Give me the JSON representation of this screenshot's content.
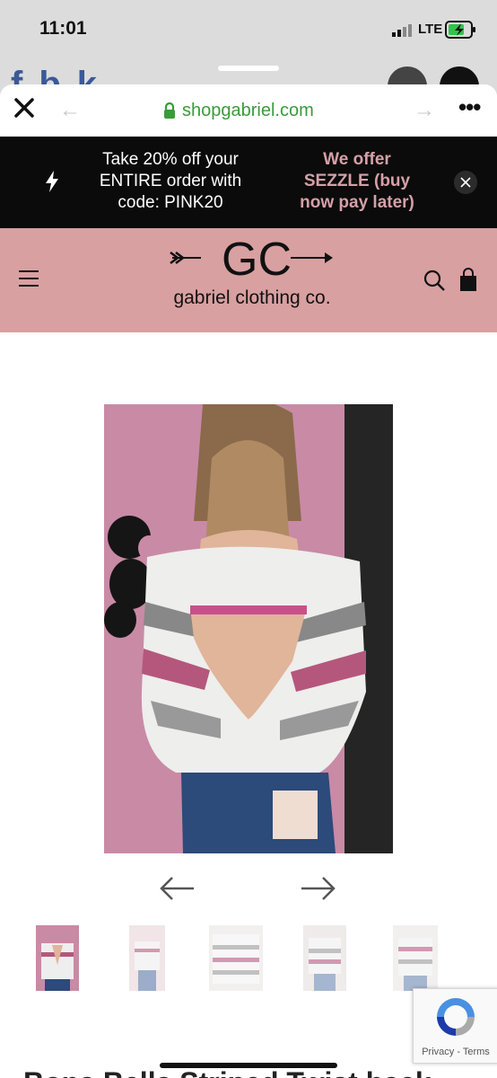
{
  "status_bar": {
    "time": "11:01",
    "network": "LTE"
  },
  "browser": {
    "url": "shopgabriel.com"
  },
  "promo": {
    "message": "Take 20% off your ENTIRE order with code: PINK20",
    "sezzle": "We offer SEZZLE (buy now pay later)"
  },
  "brand": {
    "monogram": "GC",
    "name": "gabriel clothing co."
  },
  "recaptcha": {
    "privacy": "Privacy",
    "separator": " - ",
    "terms": "Terms"
  },
  "product": {
    "title_partial": "Bona Bella Striped Twist back"
  },
  "colors": {
    "header_pink": "#d8a0a1",
    "promo_black": "#0b0b0b",
    "sezzle_pink": "#d5a0a8",
    "url_green": "#3a9b3a"
  }
}
